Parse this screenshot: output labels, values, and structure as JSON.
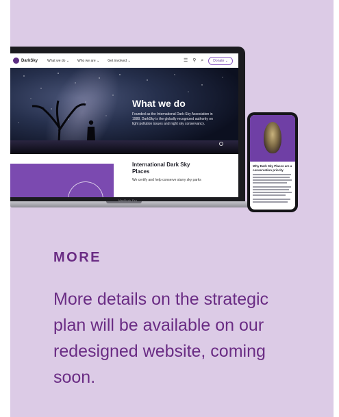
{
  "colors": {
    "card_background": "#dccbe6",
    "accent_purple": "#6a2c84",
    "site_purple": "#7b4ab0"
  },
  "laptop": {
    "model_label": "MacBook Pro",
    "site": {
      "logo_text": "DarkSky",
      "nav": [
        "What we do ⌄",
        "Who we are ⌄",
        "Get involved ⌄"
      ],
      "icons": [
        "menu-icon",
        "user-icon",
        "search-icon"
      ],
      "donate_label": "Donate ⌄",
      "hero_title": "What we do",
      "hero_text": "Founded as the International Dark-Sky Association in 1988, DarkSky is the globally recognized authority on light pollution issues and night sky conservancy.",
      "section_title": "International Dark Sky Places",
      "section_text": "We certify and help conserve starry sky parks"
    }
  },
  "phone": {
    "title": "Why Dark Sky Places are a conservation priority"
  },
  "section": {
    "label": "MORE",
    "body": "More details on the strategic plan will be available on our redesigned website, coming soon."
  }
}
